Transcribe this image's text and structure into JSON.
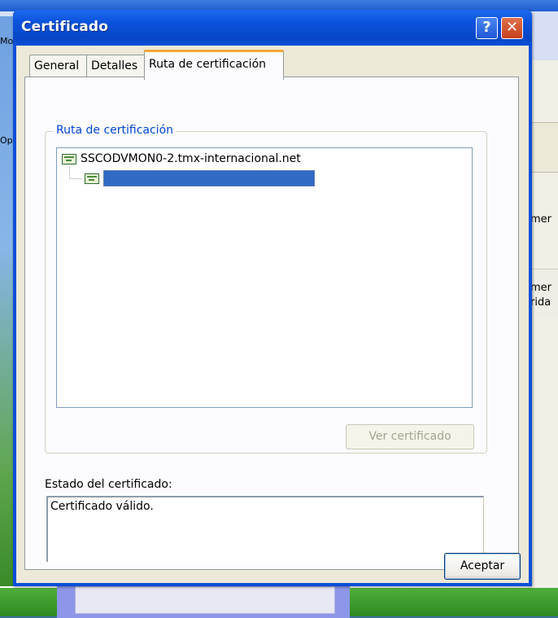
{
  "background": {
    "left_text_1": "Mo",
    "left_text_2": "Op",
    "right_text_1": "mer",
    "right_text_2": "mer",
    "right_text_3": "rida"
  },
  "dialog": {
    "title": "Certificado",
    "help_button": "?",
    "close_button": "✕",
    "tabs": [
      {
        "label": "General",
        "active": false
      },
      {
        "label": "Detalles",
        "active": false
      },
      {
        "label": "Ruta de certificación",
        "active": true
      }
    ],
    "path_group": {
      "label": "Ruta de certificación",
      "tree": [
        {
          "label": "SSCODVMON0-2.tmx-internacional.net",
          "icon": "certificate-icon",
          "level": 0
        },
        {
          "label": "",
          "icon": "certificate-icon",
          "level": 1,
          "selected": true
        }
      ],
      "view_button": "Ver certificado",
      "view_button_enabled": false
    },
    "status": {
      "label": "Estado del certificado:",
      "value": "Certificado válido."
    },
    "ok_button": "Aceptar"
  },
  "colors": {
    "titlebar": "#0a52dc",
    "active_tab_accent": "#f5a733",
    "selection": "#316ac5",
    "group_label": "#0046d5"
  }
}
